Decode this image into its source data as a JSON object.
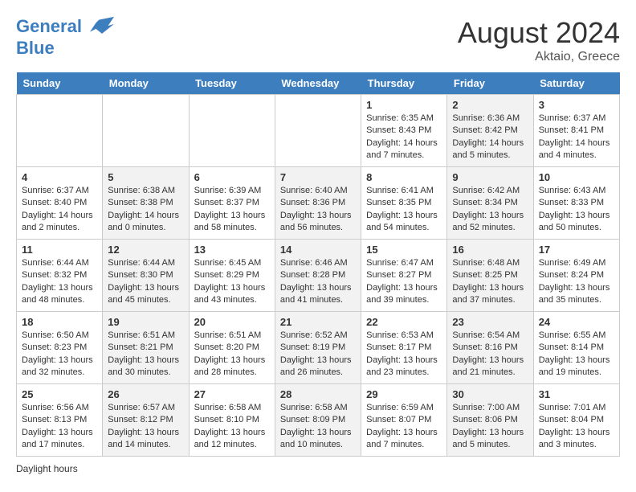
{
  "header": {
    "logo_line1": "General",
    "logo_line2": "Blue",
    "month": "August 2024",
    "location": "Aktaio, Greece"
  },
  "days_of_week": [
    "Sunday",
    "Monday",
    "Tuesday",
    "Wednesday",
    "Thursday",
    "Friday",
    "Saturday"
  ],
  "weeks": [
    [
      {
        "day": "",
        "info": "",
        "shaded": false
      },
      {
        "day": "",
        "info": "",
        "shaded": false
      },
      {
        "day": "",
        "info": "",
        "shaded": false
      },
      {
        "day": "",
        "info": "",
        "shaded": false
      },
      {
        "day": "1",
        "info": "Sunrise: 6:35 AM\nSunset: 8:43 PM\nDaylight: 14 hours\nand 7 minutes.",
        "shaded": false
      },
      {
        "day": "2",
        "info": "Sunrise: 6:36 AM\nSunset: 8:42 PM\nDaylight: 14 hours\nand 5 minutes.",
        "shaded": true
      },
      {
        "day": "3",
        "info": "Sunrise: 6:37 AM\nSunset: 8:41 PM\nDaylight: 14 hours\nand 4 minutes.",
        "shaded": false
      }
    ],
    [
      {
        "day": "4",
        "info": "Sunrise: 6:37 AM\nSunset: 8:40 PM\nDaylight: 14 hours\nand 2 minutes.",
        "shaded": false
      },
      {
        "day": "5",
        "info": "Sunrise: 6:38 AM\nSunset: 8:38 PM\nDaylight: 14 hours\nand 0 minutes.",
        "shaded": true
      },
      {
        "day": "6",
        "info": "Sunrise: 6:39 AM\nSunset: 8:37 PM\nDaylight: 13 hours\nand 58 minutes.",
        "shaded": false
      },
      {
        "day": "7",
        "info": "Sunrise: 6:40 AM\nSunset: 8:36 PM\nDaylight: 13 hours\nand 56 minutes.",
        "shaded": true
      },
      {
        "day": "8",
        "info": "Sunrise: 6:41 AM\nSunset: 8:35 PM\nDaylight: 13 hours\nand 54 minutes.",
        "shaded": false
      },
      {
        "day": "9",
        "info": "Sunrise: 6:42 AM\nSunset: 8:34 PM\nDaylight: 13 hours\nand 52 minutes.",
        "shaded": true
      },
      {
        "day": "10",
        "info": "Sunrise: 6:43 AM\nSunset: 8:33 PM\nDaylight: 13 hours\nand 50 minutes.",
        "shaded": false
      }
    ],
    [
      {
        "day": "11",
        "info": "Sunrise: 6:44 AM\nSunset: 8:32 PM\nDaylight: 13 hours\nand 48 minutes.",
        "shaded": false
      },
      {
        "day": "12",
        "info": "Sunrise: 6:44 AM\nSunset: 8:30 PM\nDaylight: 13 hours\nand 45 minutes.",
        "shaded": true
      },
      {
        "day": "13",
        "info": "Sunrise: 6:45 AM\nSunset: 8:29 PM\nDaylight: 13 hours\nand 43 minutes.",
        "shaded": false
      },
      {
        "day": "14",
        "info": "Sunrise: 6:46 AM\nSunset: 8:28 PM\nDaylight: 13 hours\nand 41 minutes.",
        "shaded": true
      },
      {
        "day": "15",
        "info": "Sunrise: 6:47 AM\nSunset: 8:27 PM\nDaylight: 13 hours\nand 39 minutes.",
        "shaded": false
      },
      {
        "day": "16",
        "info": "Sunrise: 6:48 AM\nSunset: 8:25 PM\nDaylight: 13 hours\nand 37 minutes.",
        "shaded": true
      },
      {
        "day": "17",
        "info": "Sunrise: 6:49 AM\nSunset: 8:24 PM\nDaylight: 13 hours\nand 35 minutes.",
        "shaded": false
      }
    ],
    [
      {
        "day": "18",
        "info": "Sunrise: 6:50 AM\nSunset: 8:23 PM\nDaylight: 13 hours\nand 32 minutes.",
        "shaded": false
      },
      {
        "day": "19",
        "info": "Sunrise: 6:51 AM\nSunset: 8:21 PM\nDaylight: 13 hours\nand 30 minutes.",
        "shaded": true
      },
      {
        "day": "20",
        "info": "Sunrise: 6:51 AM\nSunset: 8:20 PM\nDaylight: 13 hours\nand 28 minutes.",
        "shaded": false
      },
      {
        "day": "21",
        "info": "Sunrise: 6:52 AM\nSunset: 8:19 PM\nDaylight: 13 hours\nand 26 minutes.",
        "shaded": true
      },
      {
        "day": "22",
        "info": "Sunrise: 6:53 AM\nSunset: 8:17 PM\nDaylight: 13 hours\nand 23 minutes.",
        "shaded": false
      },
      {
        "day": "23",
        "info": "Sunrise: 6:54 AM\nSunset: 8:16 PM\nDaylight: 13 hours\nand 21 minutes.",
        "shaded": true
      },
      {
        "day": "24",
        "info": "Sunrise: 6:55 AM\nSunset: 8:14 PM\nDaylight: 13 hours\nand 19 minutes.",
        "shaded": false
      }
    ],
    [
      {
        "day": "25",
        "info": "Sunrise: 6:56 AM\nSunset: 8:13 PM\nDaylight: 13 hours\nand 17 minutes.",
        "shaded": false
      },
      {
        "day": "26",
        "info": "Sunrise: 6:57 AM\nSunset: 8:12 PM\nDaylight: 13 hours\nand 14 minutes.",
        "shaded": true
      },
      {
        "day": "27",
        "info": "Sunrise: 6:58 AM\nSunset: 8:10 PM\nDaylight: 13 hours\nand 12 minutes.",
        "shaded": false
      },
      {
        "day": "28",
        "info": "Sunrise: 6:58 AM\nSunset: 8:09 PM\nDaylight: 13 hours\nand 10 minutes.",
        "shaded": true
      },
      {
        "day": "29",
        "info": "Sunrise: 6:59 AM\nSunset: 8:07 PM\nDaylight: 13 hours\nand 7 minutes.",
        "shaded": false
      },
      {
        "day": "30",
        "info": "Sunrise: 7:00 AM\nSunset: 8:06 PM\nDaylight: 13 hours\nand 5 minutes.",
        "shaded": true
      },
      {
        "day": "31",
        "info": "Sunrise: 7:01 AM\nSunset: 8:04 PM\nDaylight: 13 hours\nand 3 minutes.",
        "shaded": false
      }
    ]
  ],
  "footer": "Daylight hours"
}
